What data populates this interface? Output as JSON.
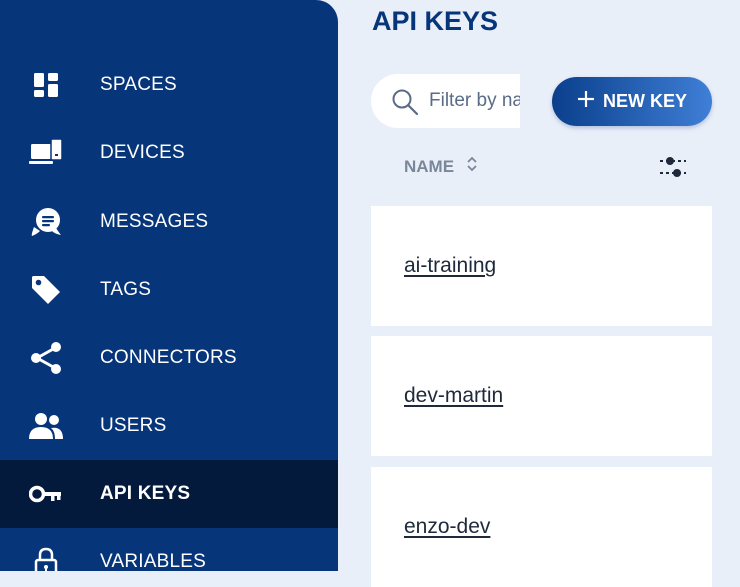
{
  "sidebar": {
    "items": [
      {
        "label": "SPACES",
        "icon": "spaces-icon"
      },
      {
        "label": "DEVICES",
        "icon": "devices-icon"
      },
      {
        "label": "MESSAGES",
        "icon": "messages-icon"
      },
      {
        "label": "TAGS",
        "icon": "tag-icon"
      },
      {
        "label": "CONNECTORS",
        "icon": "share-icon"
      },
      {
        "label": "USERS",
        "icon": "users-icon"
      },
      {
        "label": "API KEYS",
        "icon": "key-icon",
        "active": true
      },
      {
        "label": "VARIABLES",
        "icon": "lock-icon"
      }
    ]
  },
  "main": {
    "title": "API KEYS",
    "search": {
      "placeholder": "Filter by name",
      "value": ""
    },
    "new_key_label": "NEW KEY",
    "table": {
      "column_name": "NAME"
    },
    "keys": [
      {
        "name": "ai-training"
      },
      {
        "name": "dev-martin"
      },
      {
        "name": "enzo-dev"
      }
    ]
  },
  "colors": {
    "sidebar_bg": "#06357a",
    "sidebar_active_bg": "#031a3d",
    "page_bg": "#e9eff9",
    "title": "#06357a",
    "button_gradient_start": "#0a3f8c",
    "button_gradient_end": "#3f7fd6"
  }
}
